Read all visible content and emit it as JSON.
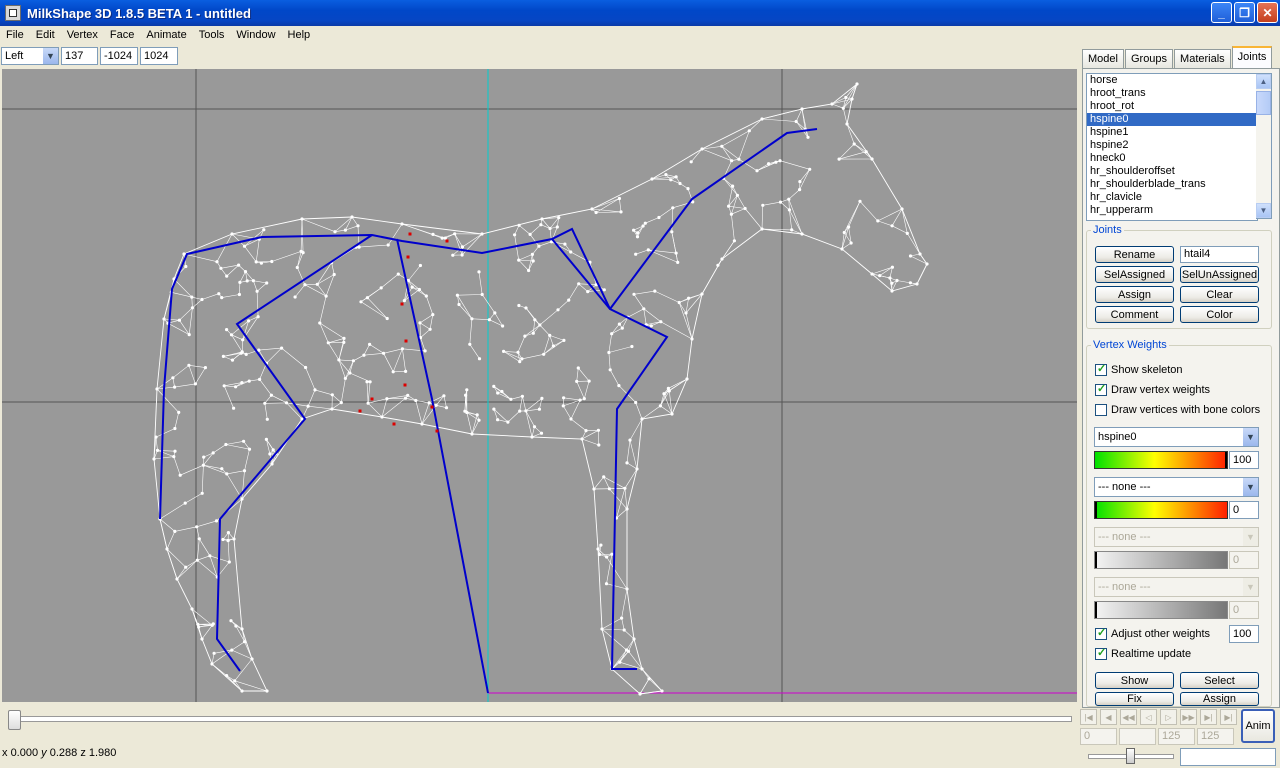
{
  "window": {
    "title": "MilkShape 3D 1.8.5 BETA 1 - untitled"
  },
  "menu": [
    "File",
    "Edit",
    "Vertex",
    "Face",
    "Animate",
    "Tools",
    "Window",
    "Help"
  ],
  "toolbar": {
    "view": "Left",
    "x": "137",
    "y": "-1024",
    "z": "1024"
  },
  "tabs": [
    "Model",
    "Groups",
    "Materials",
    "Joints"
  ],
  "joints_list": [
    "horse",
    "hroot_trans",
    "hroot_rot",
    "hspine0",
    "hspine1",
    "hspine2",
    "hneck0",
    "hr_shoulderoffset",
    "hr_shoulderblade_trans",
    "hr_clavicle",
    "hr_upperarm"
  ],
  "selected_joint_index": 3,
  "joints_group": {
    "legend": "Joints",
    "rename": "Rename",
    "name_value": "htail4",
    "sel_assigned": "SelAssigned",
    "sel_unassigned": "SelUnAssigned",
    "assign": "Assign",
    "clear": "Clear",
    "comment": "Comment",
    "color": "Color"
  },
  "vertex_weights": {
    "legend": "Vertex Weights",
    "show_skeleton": "Show skeleton",
    "draw_vertex_weights": "Draw vertex weights",
    "draw_bone_colors": "Draw vertices with bone colors",
    "bones": [
      {
        "name": "hspine0",
        "weight": "100",
        "enabled": true
      },
      {
        "name": "--- none ---",
        "weight": "0",
        "enabled": true
      },
      {
        "name": "--- none ---",
        "weight": "0",
        "enabled": false
      },
      {
        "name": "--- none ---",
        "weight": "0",
        "enabled": false
      }
    ],
    "adjust_other": "Adjust other weights",
    "adjust_value": "100",
    "realtime": "Realtime update",
    "show": "Show",
    "select": "Select",
    "fix": "Fix",
    "assign": "Assign"
  },
  "animation": {
    "frames": [
      "0",
      "",
      "125",
      "125"
    ],
    "anim_button": "Anim"
  },
  "status": {
    "x": "0.000",
    "y": "0.288",
    "z": "1.980"
  },
  "colors": {
    "skeleton": "#0000cc",
    "viewport": "#999999",
    "axis": "#00d0d0",
    "ground": "#d000d0"
  }
}
